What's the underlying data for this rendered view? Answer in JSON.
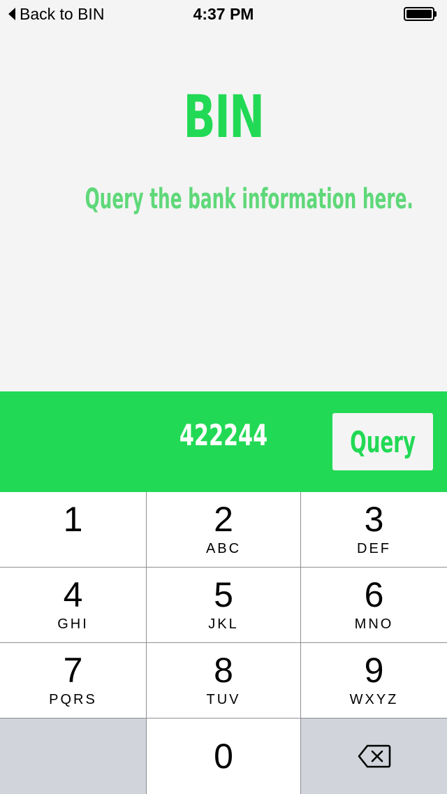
{
  "status_bar": {
    "back_label": "Back to BIN",
    "time": "4:37 PM",
    "battery_level": 1.0
  },
  "hero": {
    "title": "BIN",
    "subtitle": "Query the bank information here."
  },
  "query_bar": {
    "input_value": "422244",
    "button_label": "Query"
  },
  "keypad": {
    "keys": [
      {
        "digit": "1",
        "letters": ""
      },
      {
        "digit": "2",
        "letters": "ABC"
      },
      {
        "digit": "3",
        "letters": "DEF"
      },
      {
        "digit": "4",
        "letters": "GHI"
      },
      {
        "digit": "5",
        "letters": "JKL"
      },
      {
        "digit": "6",
        "letters": "MNO"
      },
      {
        "digit": "7",
        "letters": "PQRS"
      },
      {
        "digit": "8",
        "letters": "TUV"
      },
      {
        "digit": "9",
        "letters": "WXYZ"
      },
      {
        "digit": "0",
        "letters": ""
      }
    ],
    "backspace_icon": "backspace-icon"
  },
  "colors": {
    "accent": "#22d955",
    "subtitle": "#5fd879",
    "background": "#f4f4f4",
    "keypad_dark_key": "#d1d5db"
  }
}
